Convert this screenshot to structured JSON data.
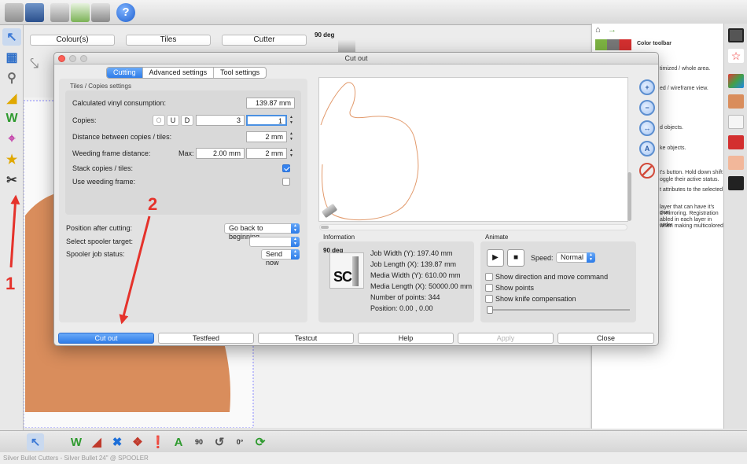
{
  "panel": {
    "colour_label": "Colour(s)",
    "tiles_label": "Tiles",
    "cutter_label": "Cutter",
    "rotation_label": "90 deg"
  },
  "right_panel": {
    "title": "Color toolbar",
    "lines": [
      "timized / whole area.",
      "ed / wireframe view.",
      "d objects.",
      "ke objects.",
      "t's button. Hold down shift",
      "oggle their active status.",
      "t attributes to the selected",
      "layer that can have it's own",
      "d mirroring. Registration",
      "abled in each layer in order",
      "when making multicolored"
    ]
  },
  "dialog": {
    "title": "Cut out",
    "tabs": [
      "Cutting",
      "Advanced settings",
      "Tool settings"
    ],
    "group_title": "Tiles / Copies settings",
    "calc_label": "Calculated vinyl consumption:",
    "calc_value": "139.87 mm",
    "copies_label": "Copies:",
    "copies_buttons": [
      "O",
      "U",
      "D"
    ],
    "copies_value_1": "3",
    "copies_value_2": "1",
    "distance_label": "Distance between copies / tiles:",
    "distance_value": "2 mm",
    "weeding_label": "Weeding frame distance:",
    "weeding_max_label": "Max:",
    "weeding_max_value": "2.00 mm",
    "weeding_value": "2 mm",
    "stack_label": "Stack copies / tiles:",
    "use_weeding_label": "Use weeding frame:",
    "position_label": "Position after cutting:",
    "position_value": "Go back to beginning",
    "spooler_label": "Select spooler target:",
    "spooler_value": "",
    "status_label": "Spooler job status:",
    "status_value": "Send now",
    "info_title": "Information",
    "info_rotation": "90 deg",
    "info_logo": "SC",
    "info_lines": [
      "Job Width (Y): 197.40 mm",
      "Job Length (X): 139.87 mm",
      "Media Width (Y): 610.00 mm",
      "Media Length (X): 50000.00 mm",
      "Number of points: 344",
      "Position: 0.00 , 0.00"
    ],
    "anim_title": "Animate",
    "speed_label": "Speed:",
    "speed_value": "Normal",
    "anim_options": [
      "Show direction and move command",
      "Show points",
      "Show knife compensation"
    ],
    "buttons": [
      "Cut out",
      "Testfeed",
      "Testcut",
      "Help",
      "Apply",
      "Close"
    ]
  },
  "bottom_toolbar": {
    "rotation_90": "90",
    "rotation_0": "0°"
  },
  "status_bar": "Silver Bullet Cutters - Silver Bullet 24\" @ SPOOLER",
  "annotations": {
    "marker_1": "1",
    "marker_2": "2"
  },
  "colors": {
    "accent": "#2f7de9",
    "shape_fill": "#d98d5c",
    "annotation": "#e5322b"
  }
}
